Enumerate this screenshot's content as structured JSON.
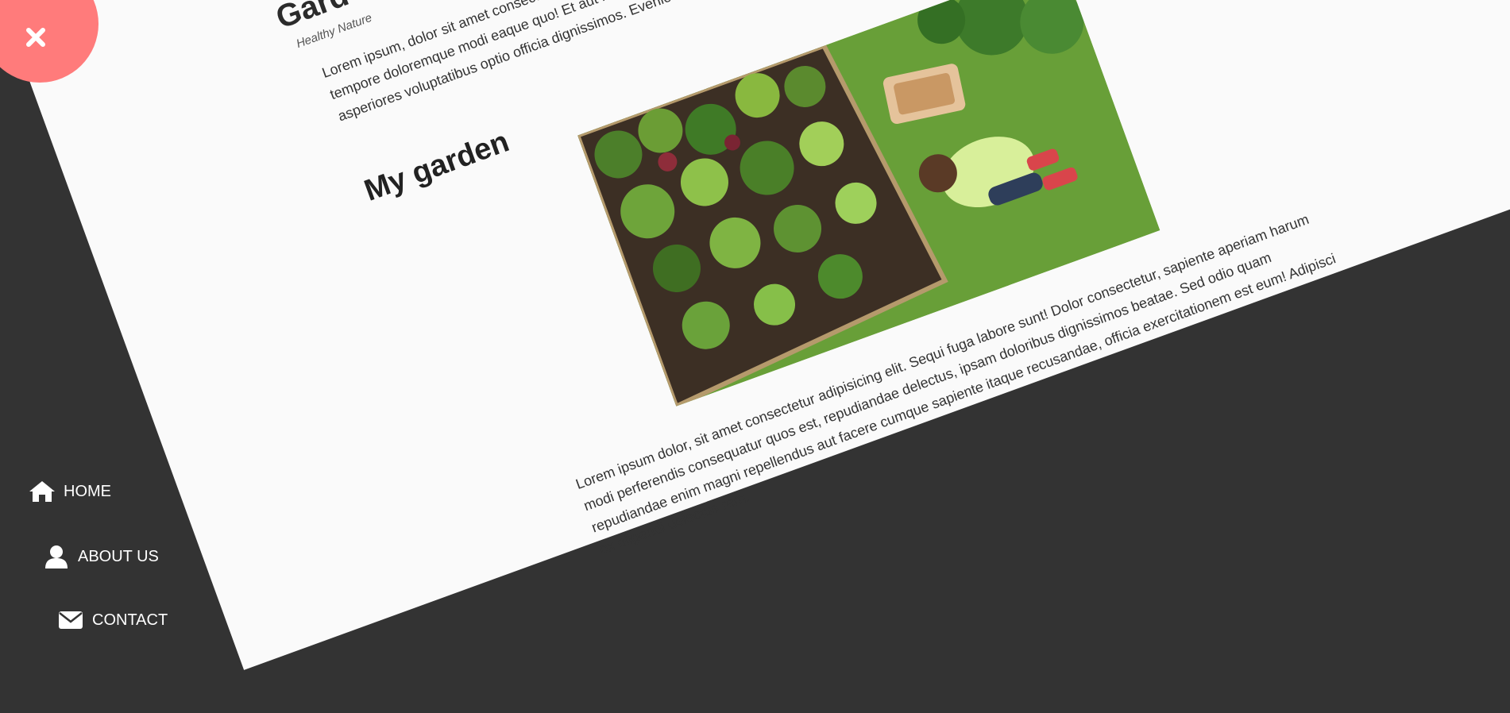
{
  "header": {
    "title": "Gard",
    "subtitle": "Healthy Nature"
  },
  "intro_text": "Lorem ipsum, dolor sit amet consectetur adipisicing elit. Tenetur, in repellat voluptatum odit ratione qui! Et aut illo minima odio tempore doloremque modi eaque quo! Et aut illo minima dolorum sunt. Harum illum enim fugiat sequi voluptas, odio expedita vero asperiores voluptatibus optio officia dignissimos. Eveniet temporibus dolor? Odit id incidunt laboriosam?",
  "section": {
    "title": "My garden",
    "image_alt": "woman-gardening-photo",
    "body": "Lorem ipsum dolor, sit amet consectetur adipisicing elit. Sequi fuga labore sunt! Dolor consectetur, sapiente aperiam harum modi perferendis consequatur quos est, repudiandae delectus, ipsam doloribus dignissimos beatae. Sed odio quam repudiandae enim magni repellendus aut facere cumque sapiente itaque recusandae, officia exercitationem est eum! Adipisci ex eligendi delectus rem."
  },
  "menu_toggle": {
    "icon": "close-icon",
    "color": "#ff7b7b"
  },
  "nav": {
    "items": [
      {
        "label": "HOME",
        "icon": "home-icon"
      },
      {
        "label": "ABOUT US",
        "icon": "user-icon"
      },
      {
        "label": "CONTACT",
        "icon": "envelope-icon"
      }
    ]
  },
  "colors": {
    "background": "#333333",
    "page": "#fafafa",
    "accent": "#ff7b7b",
    "text": "#333333"
  }
}
